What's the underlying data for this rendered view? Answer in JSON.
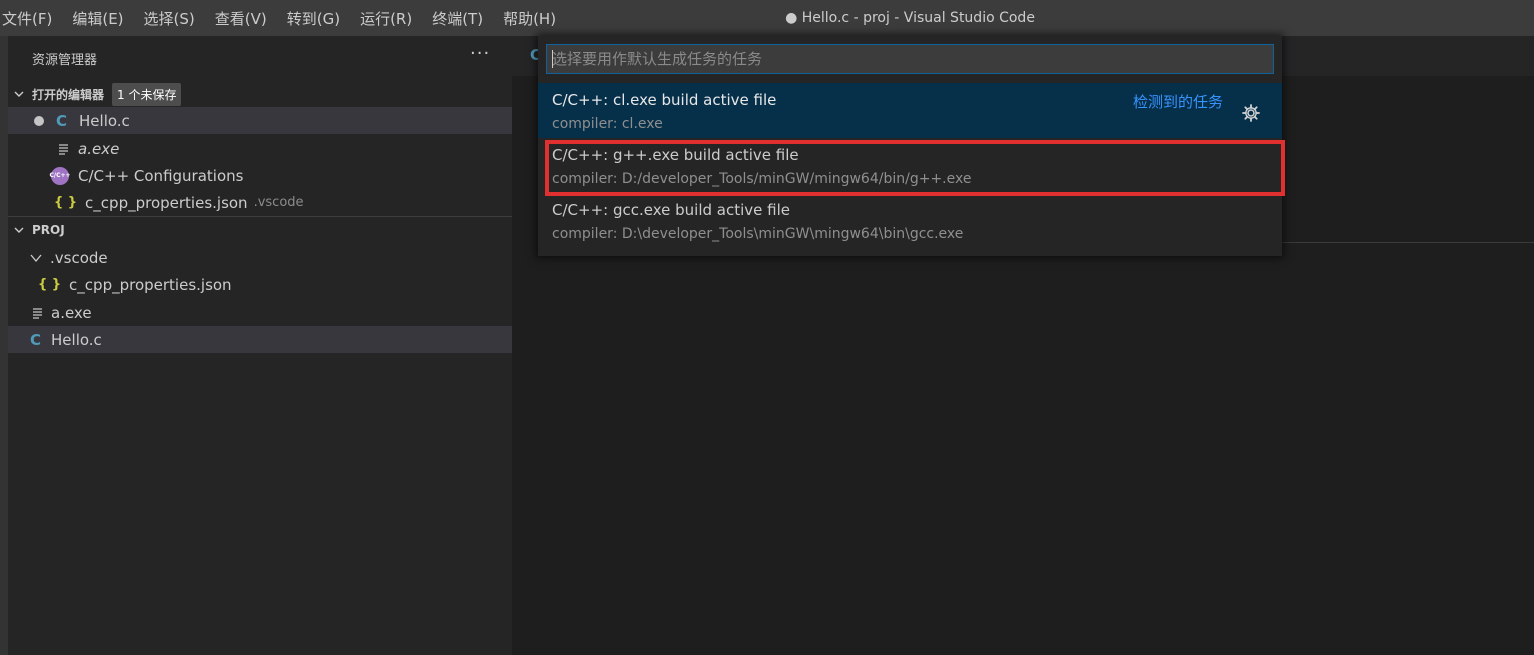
{
  "menu": [
    "文件(F)",
    "编辑(E)",
    "选择(S)",
    "查看(V)",
    "转到(G)",
    "运行(R)",
    "终端(T)",
    "帮助(H)"
  ],
  "window_title": "● Hello.c - proj - Visual Studio Code",
  "sidebar": {
    "title": "资源管理器",
    "more": "···",
    "open_editors": {
      "header": "打开的编辑器",
      "badge": "1 个未保存",
      "items": [
        {
          "label": "Hello.c",
          "icon": "c-file-icon"
        },
        {
          "label": "a.exe",
          "icon": "binary-file-icon"
        },
        {
          "label": "C/C++ Configurations",
          "icon": "cpp-config-icon"
        },
        {
          "label": "c_cpp_properties.json",
          "icon": "json-file-icon",
          "desc": ".vscode"
        }
      ]
    },
    "folder": {
      "header": "PROJ",
      "items": [
        {
          "label": ".vscode",
          "icon": "chevron-down-icon"
        },
        {
          "label": "c_cpp_properties.json",
          "icon": "json-file-icon"
        },
        {
          "label": "a.exe",
          "icon": "binary-file-icon"
        },
        {
          "label": "Hello.c",
          "icon": "c-file-icon"
        }
      ]
    }
  },
  "quick_pick": {
    "placeholder": "选择要用作默认生成任务的任务",
    "group_label": "检测到的任务",
    "items": [
      {
        "label": "C/C++: cl.exe build active file",
        "detail": "compiler: cl.exe"
      },
      {
        "label": "C/C++: g++.exe build active file",
        "detail": "compiler: D:/developer_Tools/minGW/mingw64/bin/g++.exe"
      },
      {
        "label": "C/C++: gcc.exe build active file",
        "detail": "compiler: D:\\developer_Tools\\minGW\\mingw64\\bin\\gcc.exe"
      }
    ]
  },
  "tab_peek": "C",
  "icons": {
    "c_glyph": "C",
    "json_glyph": "{ }",
    "cfg_glyph": "C/C++"
  },
  "colors": {
    "accent": "#3794ff",
    "highlight": "#e03030",
    "focus_row": "#062f4a",
    "c_icon": "#519aba",
    "json_icon": "#cbcb41"
  }
}
